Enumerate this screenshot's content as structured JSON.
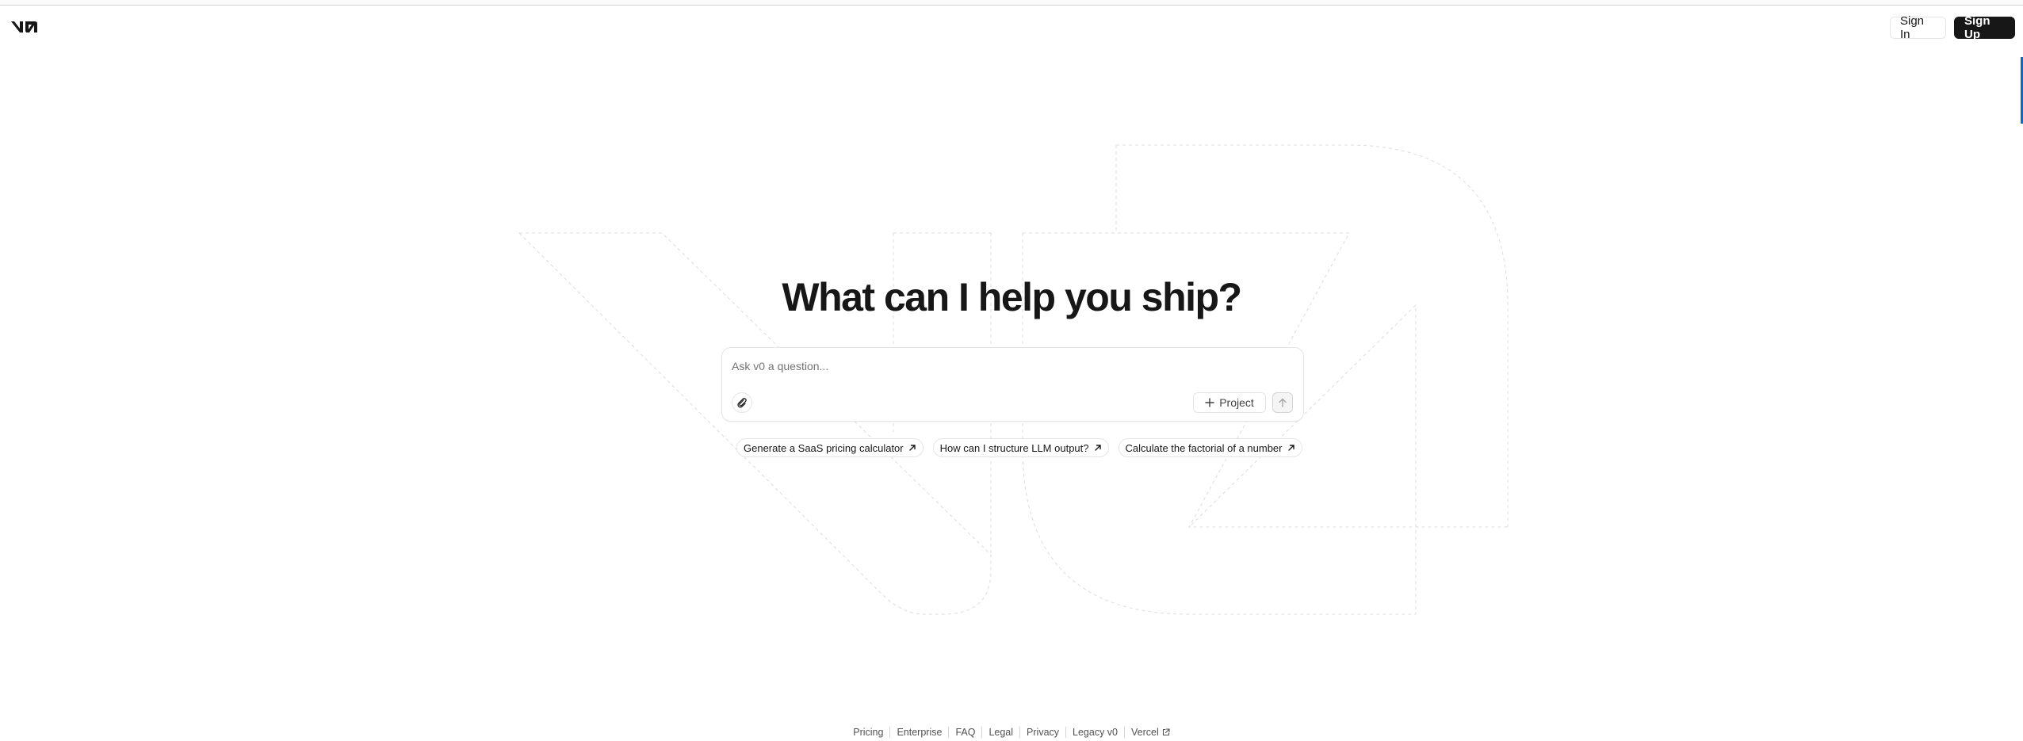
{
  "header": {
    "logo_icon": "v0-logo-icon",
    "sign_in_label": "Sign In",
    "sign_up_label": "Sign Up"
  },
  "hero": {
    "title": "What can I help you ship?"
  },
  "prompt": {
    "placeholder": "Ask v0 a question...",
    "value": "",
    "attach_icon": "paperclip-icon",
    "project_label": "Project",
    "project_icon": "plus-icon",
    "send_icon": "arrow-up-icon"
  },
  "suggestions": [
    {
      "label": "Generate a SaaS pricing calculator",
      "icon": "arrow-up-right-icon"
    },
    {
      "label": "How can I structure LLM output?",
      "icon": "arrow-up-right-icon"
    },
    {
      "label": "Calculate the factorial of a number",
      "icon": "arrow-up-right-icon"
    }
  ],
  "footer": {
    "links": [
      {
        "label": "Pricing"
      },
      {
        "label": "Enterprise"
      },
      {
        "label": "FAQ"
      },
      {
        "label": "Legal"
      },
      {
        "label": "Privacy"
      },
      {
        "label": "Legacy v0"
      },
      {
        "label": "Vercel",
        "icon": "external-link-icon"
      }
    ]
  },
  "colors": {
    "text": "#171717",
    "muted": "#737373",
    "border": "#e5e5e5",
    "primary_button": "#171717",
    "accent_scrollbar": "#0a6cbf"
  }
}
